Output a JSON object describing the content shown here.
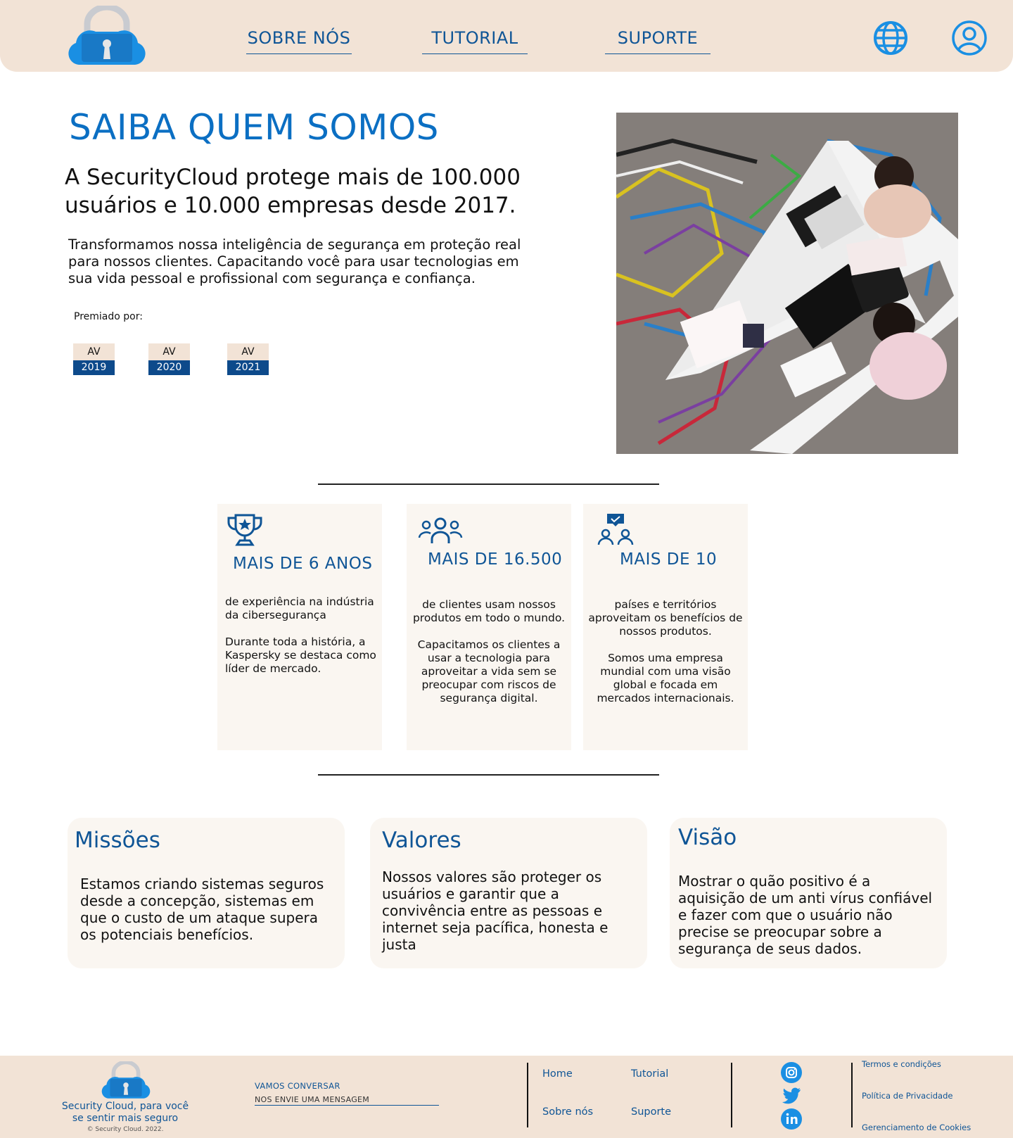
{
  "header": {
    "nav": [
      {
        "label": "SOBRE NÓS"
      },
      {
        "label": "TUTORIAL"
      },
      {
        "label": "SUPORTE"
      }
    ],
    "icons": [
      "padlock-cloud-logo",
      "globe-icon",
      "user-icon"
    ]
  },
  "hero": {
    "title": "SAIBA QUEM SOMOS",
    "subtitle": "A SecurityCloud protege mais de 100.000 usuários e 10.000 empresas desde 2017.",
    "description": "Transformamos nossa inteligência de segurança em proteção real para nossos clientes. Capacitando você para usar tecnologias em sua vida pessoal e profissional com segurança e confiança.",
    "awards_label": "Premiado por:",
    "awards": [
      {
        "top": "AV",
        "year": "2019"
      },
      {
        "top": "AV",
        "year": "2020"
      },
      {
        "top": "AV",
        "year": "2021"
      }
    ]
  },
  "stats": [
    {
      "icon": "trophy-icon",
      "title": "MAIS DE 6 ANOS",
      "text": "de experiência na indústria da cibersegurança\n\nDurante toda a história, a Kaspersky se destaca como líder de mercado."
    },
    {
      "icon": "users-icon",
      "title": "MAIS DE 16.500",
      "text": "de clientes usam nossos produtos em todo o mundo.\n\nCapacitamos os clientes a usar a tecnologia para aproveitar a vida sem se preocupar com riscos de segurança digital."
    },
    {
      "icon": "chat-users-icon",
      "title": "MAIS DE 10",
      "text": "países e territórios aproveitam os benefícios de nossos produtos.\n\nSomos uma empresa mundial com uma visão global e focada em mercados internacionais."
    }
  ],
  "cards": [
    {
      "title": "Missões",
      "text": "Estamos criando sistemas seguros desde a concepção, sistemas em que o custo de um ataque supera os potenciais benefícios."
    },
    {
      "title": "Valores",
      "text": "Nossos valores são proteger os usuários e garantir que a convivência entre as pessoas e internet seja pacífica, honesta e justa"
    },
    {
      "title": "Visão",
      "text": "Mostrar o quão positivo é a aquisição de um anti vírus confiável e fazer com que o usuário não precise se preocupar sobre a segurança de seus dados."
    }
  ],
  "footer": {
    "tagline": "Security Cloud, para você se sentir mais seguro",
    "copyright": "© Security Cloud. 2022.",
    "talk_label": "VAMOS CONVERSAR",
    "message_placeholder": "NOS ENVIE UMA MENSAGEM",
    "links": {
      "home": "Home",
      "tutorial": "Tutorial",
      "sobre": "Sobre nós",
      "suporte": "Suporte"
    },
    "social": [
      "instagram-icon",
      "twitter-icon",
      "linkedin-icon"
    ],
    "legal": [
      "Termos e condições",
      "Política de Privacidade",
      "Gerenciamento de Cookies"
    ]
  },
  "colors": {
    "brand_blue": "#0f5596",
    "title_blue": "#0b6fc3",
    "icon_blue": "#1a8fe3",
    "header_bg": "#f2e3d6",
    "card_bg": "#faf6f1",
    "award_dark": "#0d4a8b"
  }
}
